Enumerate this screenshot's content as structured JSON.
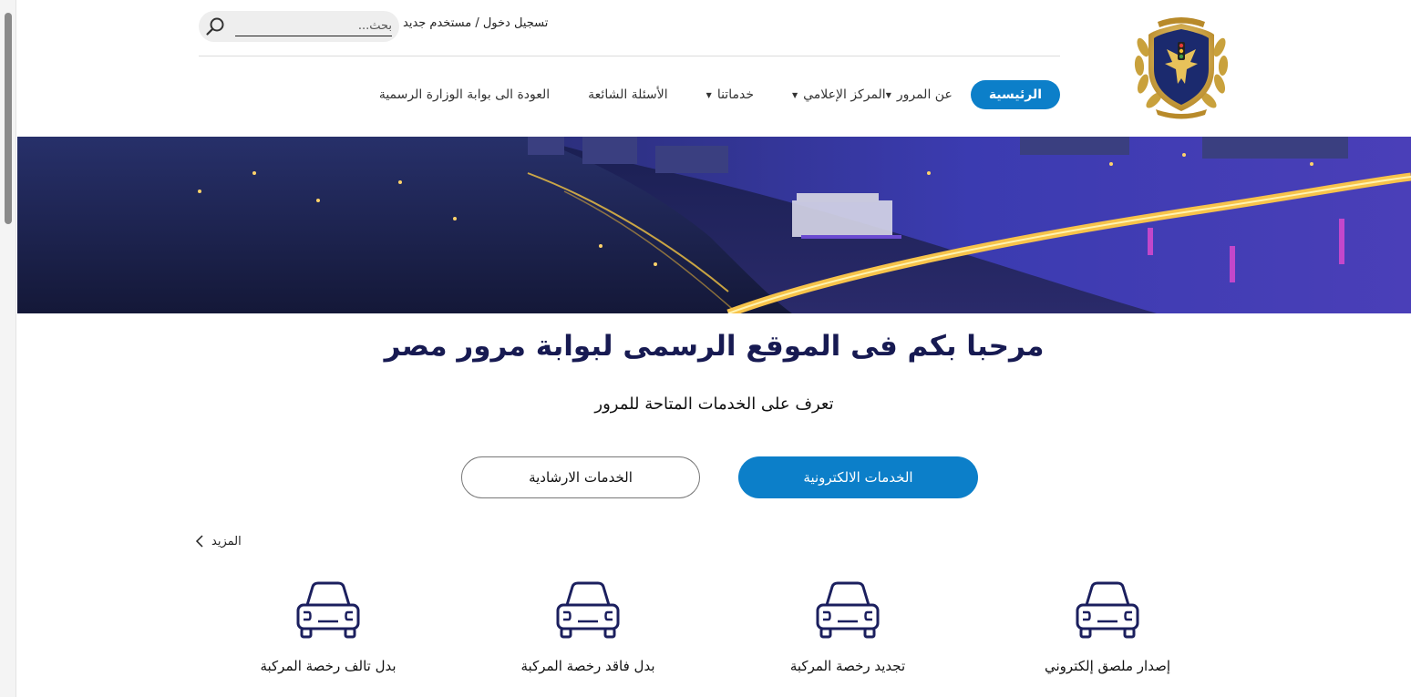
{
  "header": {
    "search": {
      "placeholder": "بحث..."
    },
    "auth": {
      "login": "تسجيل دخول",
      "separator": "/",
      "register": "مستخدم جديد"
    },
    "nav": [
      {
        "label": "الرئيسية",
        "active": true,
        "dropdown": false
      },
      {
        "label": "عن المرور",
        "active": false,
        "dropdown": true
      },
      {
        "label": "المركز الإعلامي",
        "active": false,
        "dropdown": true
      },
      {
        "label": "خدماتنا",
        "active": false,
        "dropdown": true
      },
      {
        "label": "الأسئلة الشائعة",
        "active": false,
        "dropdown": false
      },
      {
        "label": "العودة الى بوابة الوزارة الرسمية",
        "active": false,
        "dropdown": false
      }
    ]
  },
  "welcome": {
    "title": "مرحبا بكم فى الموقع الرسمى لبوابة مرور مصر",
    "subtitle": "تعرف على الخدمات المتاحة للمرور"
  },
  "buttons": {
    "electronic": "الخدمات الالكترونية",
    "guidance": "الخدمات الارشادية"
  },
  "more": {
    "label": "المزيد"
  },
  "services": [
    {
      "label": "إصدار ملصق إلكتروني",
      "icon": "car-icon"
    },
    {
      "label": "تجديد رخصة المركبة",
      "icon": "car-icon"
    },
    {
      "label": "بدل فاقد رخصة المركبة",
      "icon": "car-icon"
    },
    {
      "label": "بدل تالف رخصة المركبة",
      "icon": "car-icon"
    }
  ],
  "colors": {
    "primary": "#0c7fc9",
    "title": "#171a52",
    "navy": "#1b1f5e"
  }
}
